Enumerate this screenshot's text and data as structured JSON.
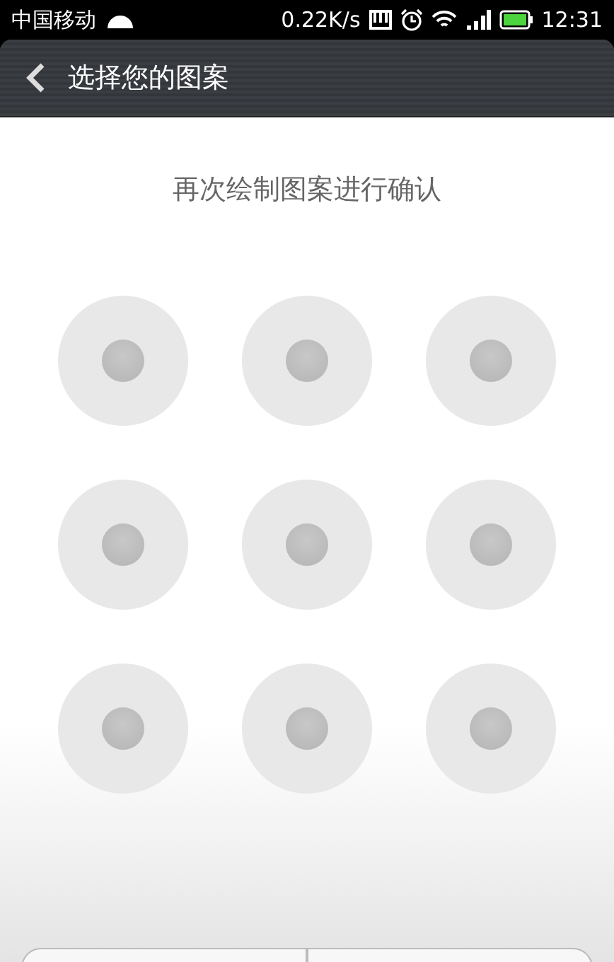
{
  "status_bar": {
    "carrier": "中国移动",
    "speed": "0.22K/s",
    "time": "12:31"
  },
  "header": {
    "title": "选择您的图案"
  },
  "prompt": "再次绘制图案进行确认",
  "dots": [
    {
      "selected": false
    },
    {
      "selected": false
    },
    {
      "selected": false
    },
    {
      "selected": false
    },
    {
      "selected": false
    },
    {
      "selected": false
    },
    {
      "selected": false
    },
    {
      "selected": false
    },
    {
      "selected": false
    }
  ],
  "buttons": [
    {
      "kind": "left"
    },
    {
      "kind": "right"
    }
  ]
}
